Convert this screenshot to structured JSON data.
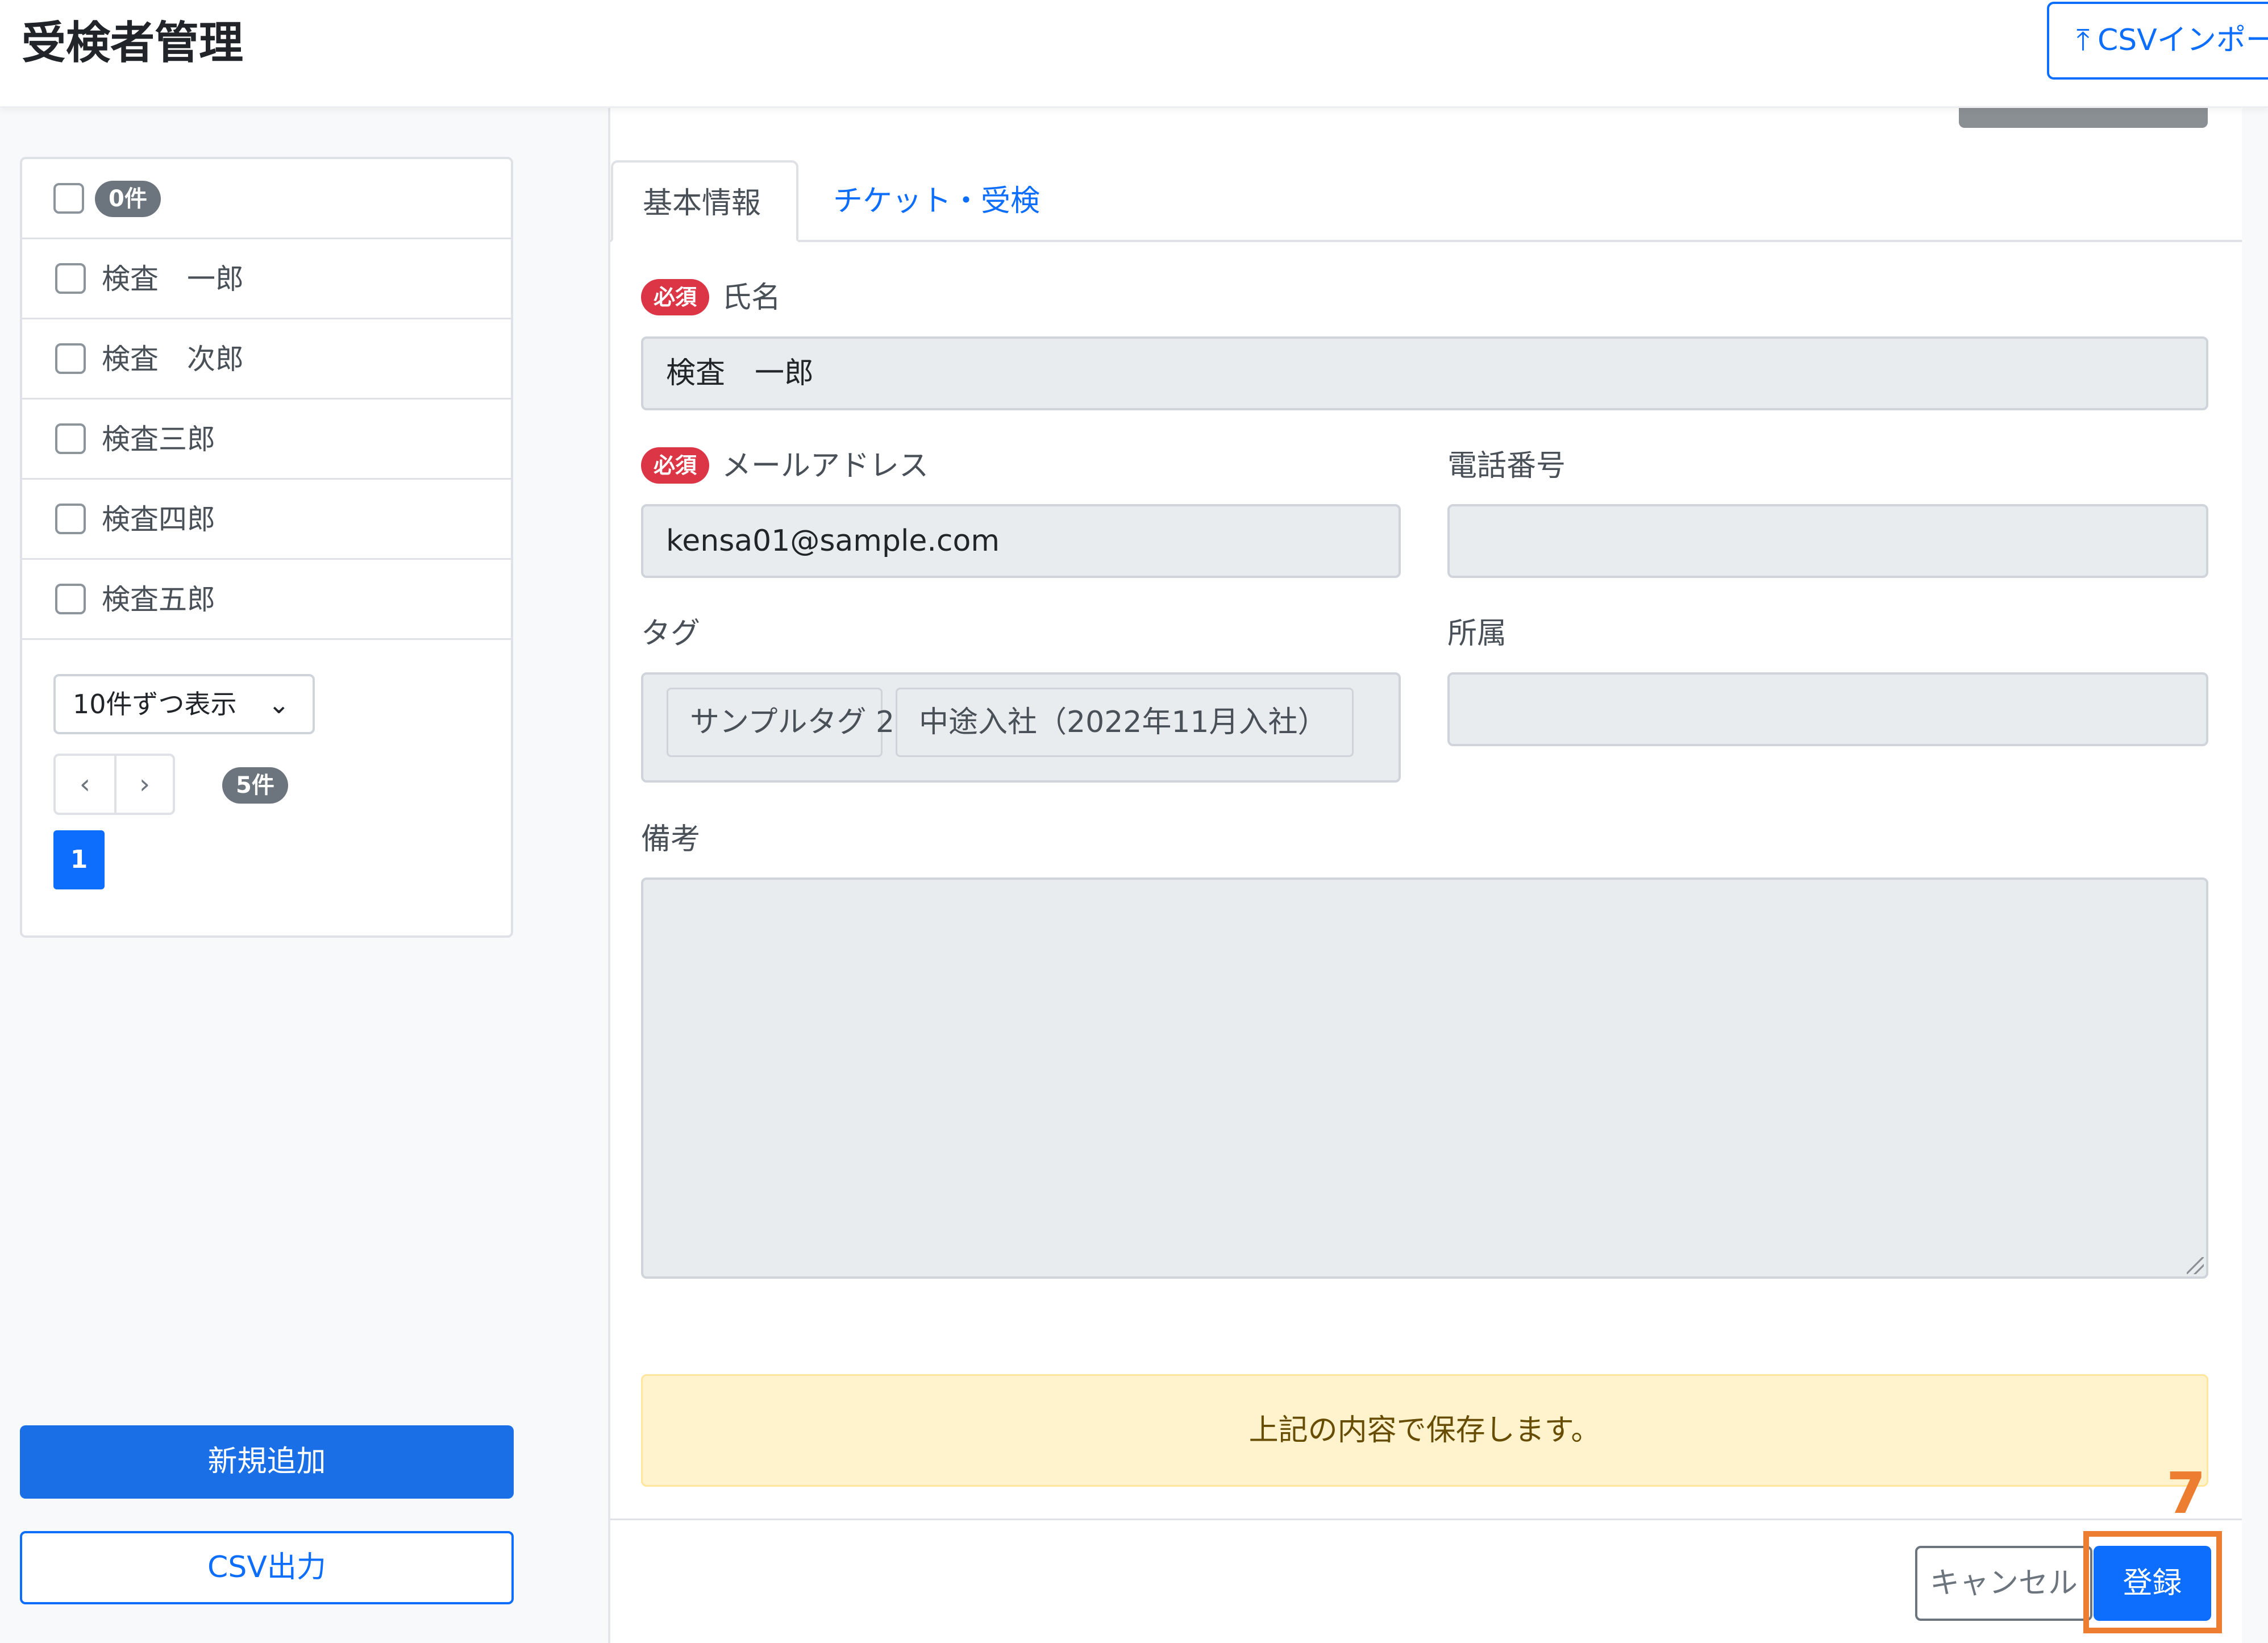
{
  "header": {
    "title": "受検者管理",
    "csv_import_label": "CSVインポート"
  },
  "sidebar": {
    "select_all_count": "0件",
    "examinees": [
      {
        "name": "検査　一郎"
      },
      {
        "name": "検査　次郎"
      },
      {
        "name": "検査三郎"
      },
      {
        "name": "検査四郎"
      },
      {
        "name": "検査五郎"
      }
    ],
    "per_page_selected": "10件ずつ表示",
    "total_count": "5件",
    "current_page": "1",
    "prev_symbol": "‹",
    "next_symbol": "›",
    "new_button_label": "新規追加",
    "csv_export_label": "CSV出力"
  },
  "tabs": [
    {
      "label": "基本情報",
      "active": true
    },
    {
      "label": "チケット・受検",
      "active": false
    }
  ],
  "form": {
    "required_badge": "必須",
    "name_label": "氏名",
    "name_value": "検査　一郎",
    "email_label": "メールアドレス",
    "email_value": "kensa01@sample.com",
    "phone_label": "電話番号",
    "phone_value": "",
    "tag_label": "タグ",
    "tags": [
      "サンプルタグ 2",
      "中途入社（2022年11月入社）"
    ],
    "affiliation_label": "所属",
    "affiliation_value": "",
    "notes_label": "備考",
    "notes_value": ""
  },
  "notice": "上記の内容で保存します。",
  "actions": {
    "cancel_label": "キャンセル",
    "register_label": "登録"
  },
  "annotation": {
    "step_number": "7",
    "color": "#ed7d31"
  },
  "colors": {
    "primary": "#0d6efd",
    "danger": "#dc3545",
    "warning_bg": "#fff3cd"
  }
}
